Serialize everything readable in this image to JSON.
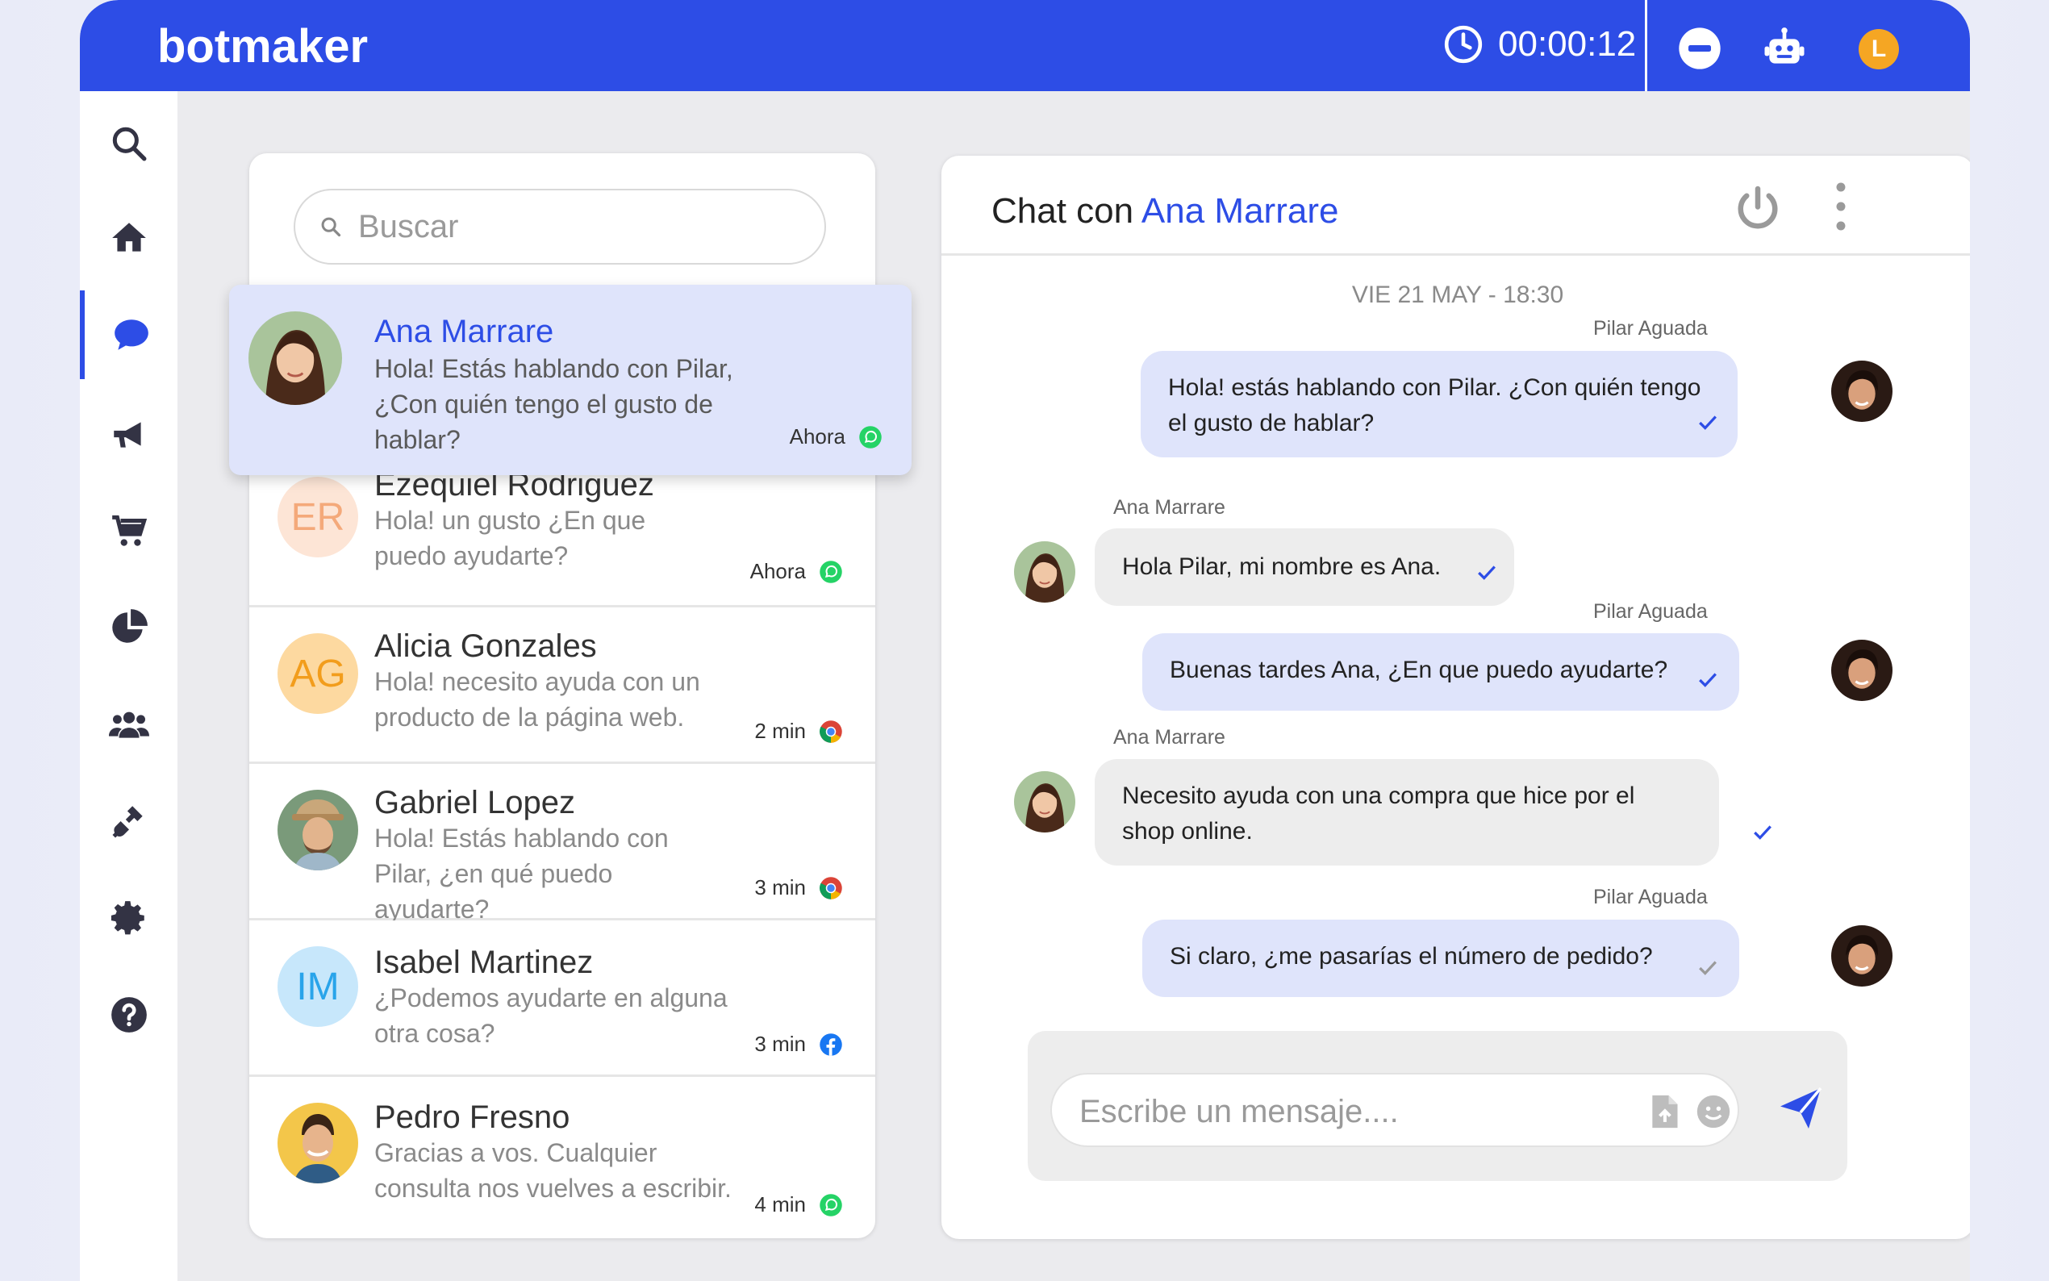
{
  "header": {
    "logo": "botmaker",
    "timer": "00:00:12",
    "user_initial": "L",
    "brand_color": "#2d4de6"
  },
  "sidebar": {
    "items": [
      {
        "icon": "search-icon"
      },
      {
        "icon": "home-icon"
      },
      {
        "icon": "chat-icon",
        "active": true
      },
      {
        "icon": "megaphone-icon"
      },
      {
        "icon": "cart-icon"
      },
      {
        "icon": "pie-chart-icon"
      },
      {
        "icon": "users-icon"
      },
      {
        "icon": "plug-icon"
      },
      {
        "icon": "gear-icon"
      },
      {
        "icon": "help-icon"
      }
    ]
  },
  "conversations": {
    "search_placeholder": "Buscar",
    "items": [
      {
        "name": "Ana Marrare",
        "preview": "Hola! Estás hablando con Pilar, ¿Con quién tengo el gusto de hablar?",
        "time": "Ahora",
        "channel": "whatsapp",
        "avatar": "photo"
      },
      {
        "name": "Ezequiel Rodriguez",
        "initials": "ER",
        "preview": "Hola! un gusto ¿En que puedo ayudarte?",
        "time": "Ahora",
        "channel": "whatsapp"
      },
      {
        "name": "Alicia Gonzales",
        "initials": "AG",
        "preview": "Hola! necesito ayuda con un producto de la página web.",
        "time": "2 min",
        "channel": "chrome"
      },
      {
        "name": "Gabriel Lopez",
        "preview": "Hola! Estás hablando con Pilar, ¿en qué puedo ayudarte?",
        "time": "3 min",
        "channel": "chrome",
        "avatar": "photo"
      },
      {
        "name": "Isabel Martinez",
        "initials": "IM",
        "preview": "¿Podemos ayudarte en alguna otra cosa?",
        "time": "3 min",
        "channel": "facebook"
      },
      {
        "name": "Pedro Fresno",
        "preview": "Gracias a vos. Cualquier consulta nos vuelves a escribir.",
        "time": "4 min",
        "channel": "whatsapp",
        "avatar": "photo"
      }
    ]
  },
  "chat": {
    "title_prefix": "Chat con",
    "contact": "Ana Marrare",
    "date": "VIE 21 MAY  - 18:30",
    "messages": [
      {
        "sender": "Pilar Aguada",
        "direction": "out",
        "text": "Hola! estás hablando con Pilar.  ¿Con quién tengo el gusto de hablar?"
      },
      {
        "sender": "Ana Marrare",
        "direction": "in",
        "text": "Hola Pilar, mi nombre es Ana."
      },
      {
        "sender": "Pilar Aguada",
        "direction": "out",
        "text": "Buenas tardes Ana, ¿En que puedo ayudarte?"
      },
      {
        "sender": "Ana Marrare",
        "direction": "in",
        "text": "Necesito ayuda con una compra que hice por el shop online."
      },
      {
        "sender": "Pilar Aguada",
        "direction": "out",
        "text": "Si claro, ¿me pasarías el número de pedido?"
      }
    ],
    "input_placeholder": "Escribe un mensaje...."
  }
}
